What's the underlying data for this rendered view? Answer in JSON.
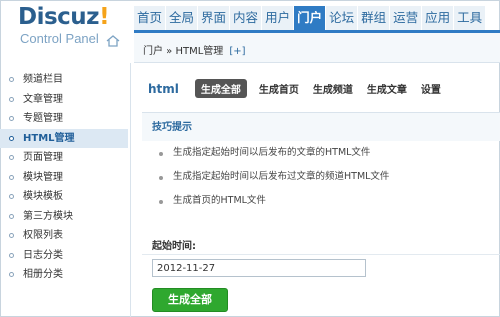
{
  "logo": {
    "brand": "Discuz",
    "bang": "!",
    "subtitle": "Control Panel"
  },
  "topnav": {
    "tabs": [
      {
        "label": "首页",
        "name": "home"
      },
      {
        "label": "全局",
        "name": "global"
      },
      {
        "label": "界面",
        "name": "interface"
      },
      {
        "label": "内容",
        "name": "content"
      },
      {
        "label": "用户",
        "name": "users"
      },
      {
        "label": "门户",
        "name": "portal",
        "active": true
      },
      {
        "label": "论坛",
        "name": "forum"
      },
      {
        "label": "群组",
        "name": "group"
      },
      {
        "label": "运营",
        "name": "operation"
      },
      {
        "label": "应用",
        "name": "apps"
      },
      {
        "label": "工具",
        "name": "tools"
      }
    ]
  },
  "breadcrumb": {
    "text": "门户 » HTML管理",
    "plus": "[+]"
  },
  "sidebar": {
    "items": [
      {
        "label": "频道栏目"
      },
      {
        "label": "文章管理"
      },
      {
        "label": "专题管理"
      },
      {
        "label": "HTML管理",
        "active": true
      },
      {
        "label": "页面管理"
      },
      {
        "label": "模块管理"
      },
      {
        "label": "模块模板"
      },
      {
        "label": "第三方模块"
      },
      {
        "label": "权限列表"
      },
      {
        "label": "日志分类"
      },
      {
        "label": "相册分类"
      }
    ]
  },
  "content": {
    "module_label": "html",
    "subtabs": [
      {
        "label": "生成全部",
        "active": true
      },
      {
        "label": "生成首页"
      },
      {
        "label": "生成频道"
      },
      {
        "label": "生成文章"
      },
      {
        "label": "设置"
      }
    ],
    "tips": {
      "title": "技巧提示",
      "items": [
        "生成指定起始时间以后发布的文章的HTML文件",
        "生成指定起始时间以后发布过文章的频道HTML文件",
        "生成首页的HTML文件"
      ]
    },
    "form": {
      "start_label": "起始时间:",
      "start_value": "2012-11-27",
      "submit_label": "生成全部"
    }
  },
  "colors": {
    "accent": "#2f7bc4",
    "submit": "#2fa82f",
    "logo_bang": "#f5a31a"
  }
}
